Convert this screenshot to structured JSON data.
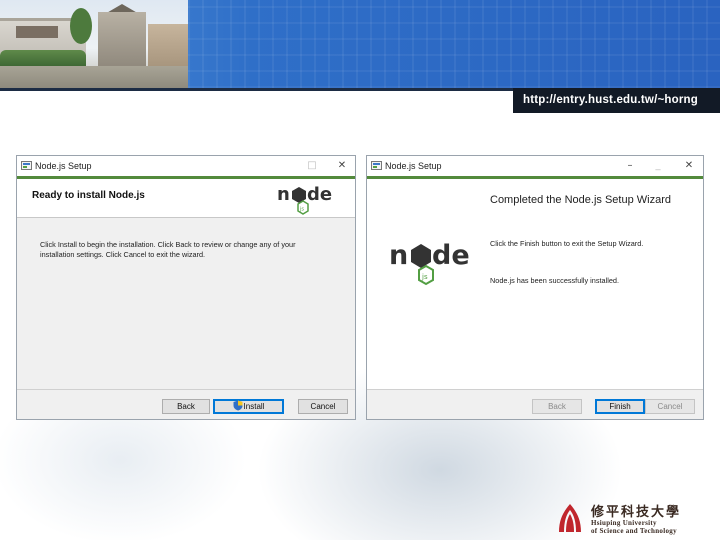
{
  "slide": {
    "url": "http://entry.hust.edu.tw/~horng",
    "university": {
      "name_cn": "修平科技大學",
      "name_en_line1": "Hsiuping University",
      "name_en_line2": "of Science and Technology"
    }
  },
  "left_window": {
    "title": "Node.js Setup",
    "titlebar_buttons": [
      "□",
      "✕"
    ],
    "heading": "Ready to install Node.js",
    "body": "Click Install to begin the installation. Click Back to review or change any of your installation settings. Click Cancel to exit the wizard.",
    "buttons": {
      "back": "Back",
      "install": "Install",
      "cancel": "Cancel"
    },
    "logo_icon": "nodejs-logo",
    "shield_icon": "uac-shield-icon"
  },
  "right_window": {
    "title": "Node.js Setup",
    "titlebar_buttons": [
      "–",
      "_",
      "✕"
    ],
    "heading": "Completed the Node.js Setup Wizard",
    "text_finish": "Click the Finish button to exit the Setup Wizard.",
    "text_success": "Node.js has been successfully installed.",
    "buttons": {
      "back": "Back",
      "finish": "Finish",
      "cancel": "Cancel"
    },
    "logo_icon": "nodejs-logo"
  },
  "colors": {
    "header_blue": "#2f6fc8",
    "node_green": "#539e43",
    "node_dark": "#333333",
    "accent_rule": "#538a3c",
    "focus_blue": "#0078d7"
  }
}
